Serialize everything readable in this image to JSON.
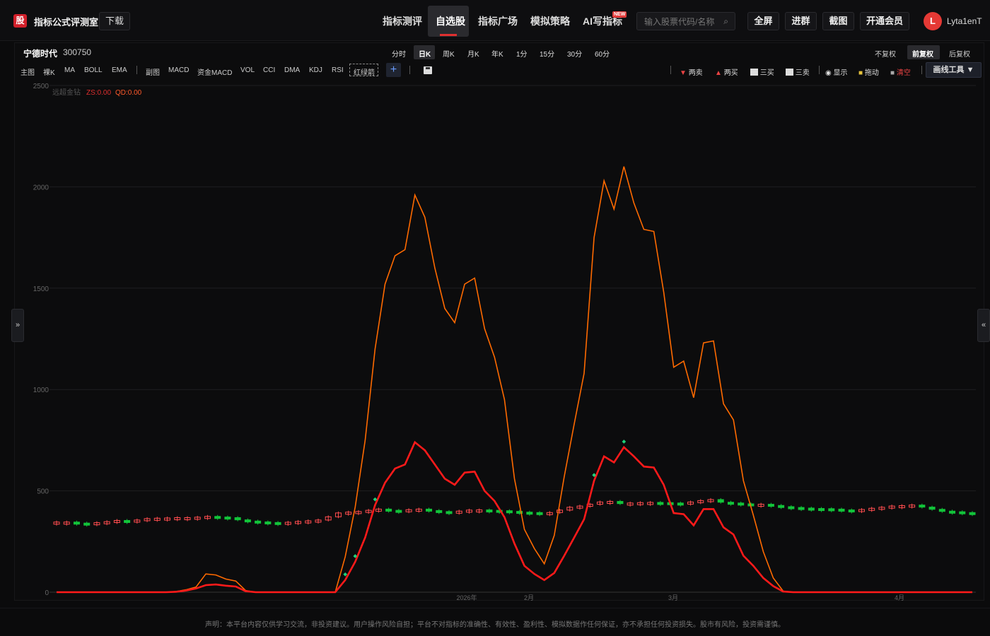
{
  "app": {
    "logo_char": "股",
    "title": "指标公式评测室",
    "download": "下载"
  },
  "nav": [
    {
      "label": "指标测评",
      "active": false
    },
    {
      "label": "自选股",
      "active": true
    },
    {
      "label": "指标广场",
      "active": false
    },
    {
      "label": "模拟策略",
      "active": false
    },
    {
      "label": "AI写指标",
      "active": false,
      "badge": "NEW"
    }
  ],
  "search": {
    "placeholder": "输入股票代码/名称",
    "icon": "search-icon"
  },
  "top_buttons": [
    "全屏",
    "进群",
    "截图",
    "开通会员"
  ],
  "user": {
    "initial": "L",
    "name": "Lyta1enT"
  },
  "stock": {
    "name": "宁德时代",
    "code": "300750"
  },
  "periods": [
    "分时",
    "日K",
    "周K",
    "月K",
    "年K",
    "1分",
    "15分",
    "30分",
    "60分"
  ],
  "active_period": "日K",
  "adjust": [
    "不复权",
    "前复权",
    "后复权"
  ],
  "active_adjust": "前复权",
  "main_tools": [
    "主图",
    "裸K",
    "MA",
    "BOLL",
    "EMA"
  ],
  "sub_tools": [
    "副图",
    "MACD",
    "资金MACD",
    "VOL",
    "CCI",
    "DMA",
    "KDJ",
    "RSI",
    "红绿箭"
  ],
  "right_tools": {
    "two_sell": "两卖",
    "two_buy": "两买",
    "three_buy": "三买",
    "three_sell": "三卖",
    "show": "显示",
    "drag": "拖动",
    "clear": "清空",
    "draw": "画线工具 ▼"
  },
  "indicator": {
    "name": "远超金钻",
    "zs": "ZS:0.00",
    "qd": "QD:0.00"
  },
  "side": {
    "left": "»",
    "right": "«"
  },
  "disclaimer": "声明：本平台内容仅供学习交流，非投资建议。用户操作风险自担；平台不对指标的准确性、有效性、盈利性、模拟数据作任何保证，亦不承担任何投资损失。股市有风险，投资需谨慎。",
  "colors": {
    "accent": "#e02f2f",
    "orange_line": "#ff6a00",
    "red_line": "#ff1a1a",
    "up": "#ff4d4f",
    "down": "#12c43a",
    "marker": "#1fd27a"
  },
  "chart_data": {
    "type": "line",
    "ylim": [
      0,
      2500
    ],
    "yticks": [
      0,
      500,
      1000,
      1500,
      2000,
      2500
    ],
    "xticks": [
      "2026年",
      "2月",
      "3月",
      "4月"
    ],
    "series": [
      {
        "name": "",
        "values": [
          0,
          0,
          0,
          0,
          0,
          0,
          0,
          0,
          0,
          0,
          0,
          0,
          3,
          12,
          25,
          90,
          85,
          65,
          55,
          8,
          0,
          0,
          0,
          0,
          0,
          0,
          0,
          0,
          0,
          175,
          420,
          750,
          1200,
          1520,
          1660,
          1690,
          1960,
          1850,
          1600,
          1400,
          1330,
          1520,
          1550,
          1300,
          1160,
          950,
          560,
          310,
          215,
          140,
          280,
          570,
          830,
          1080,
          1750,
          2030,
          1890,
          2100,
          1920,
          1790,
          1780,
          1480,
          1110,
          1140,
          960,
          1230,
          1240,
          930,
          850,
          550,
          380,
          200,
          70,
          5,
          0,
          0,
          0,
          0,
          0,
          0,
          0,
          0,
          0,
          0,
          0,
          0,
          0,
          0,
          0,
          0,
          0,
          0,
          0
        ]
      },
      {
        "name": "",
        "values": [
          0,
          0,
          0,
          0,
          0,
          0,
          0,
          0,
          0,
          0,
          0,
          0,
          2,
          8,
          18,
          35,
          38,
          32,
          28,
          5,
          0,
          0,
          0,
          0,
          0,
          0,
          0,
          0,
          0,
          60,
          150,
          270,
          430,
          540,
          610,
          630,
          740,
          700,
          630,
          560,
          530,
          590,
          595,
          500,
          450,
          370,
          240,
          130,
          90,
          60,
          95,
          180,
          270,
          360,
          550,
          670,
          640,
          715,
          670,
          620,
          615,
          530,
          390,
          385,
          330,
          410,
          410,
          320,
          285,
          180,
          130,
          70,
          30,
          3,
          0,
          0,
          0,
          0,
          0,
          0,
          0,
          0,
          0,
          0,
          0,
          0,
          0,
          0,
          0,
          0,
          0,
          0,
          0
        ]
      },
      {
        "name": "",
        "type": "candlestick",
        "values": [
          346,
          346,
          341,
          338,
          343,
          348,
          354,
          352,
          356,
          363,
          365,
          366,
          368,
          368,
          370,
          374,
          371,
          368,
          357,
          351,
          347,
          344,
          343,
          345,
          349,
          352,
          356,
          372,
          391,
          395,
          398,
          404,
          410,
          404,
          402,
          407,
          410,
          403,
          398,
          396,
          400,
          405,
          406,
          404,
          402,
          399,
          395,
          393,
          392,
          393,
          405,
          419,
          425,
          434,
          445,
          448,
          437,
          440,
          442,
          443,
          442,
          440,
          439,
          445,
          452,
          457,
          444,
          440,
          436,
          431,
          434,
          428,
          422,
          418,
          415,
          413,
          412,
          410,
          406,
          405,
          408,
          414,
          419,
          425,
          427,
          430,
          420,
          409,
          400,
          397,
          393,
          385
        ]
      }
    ]
  }
}
